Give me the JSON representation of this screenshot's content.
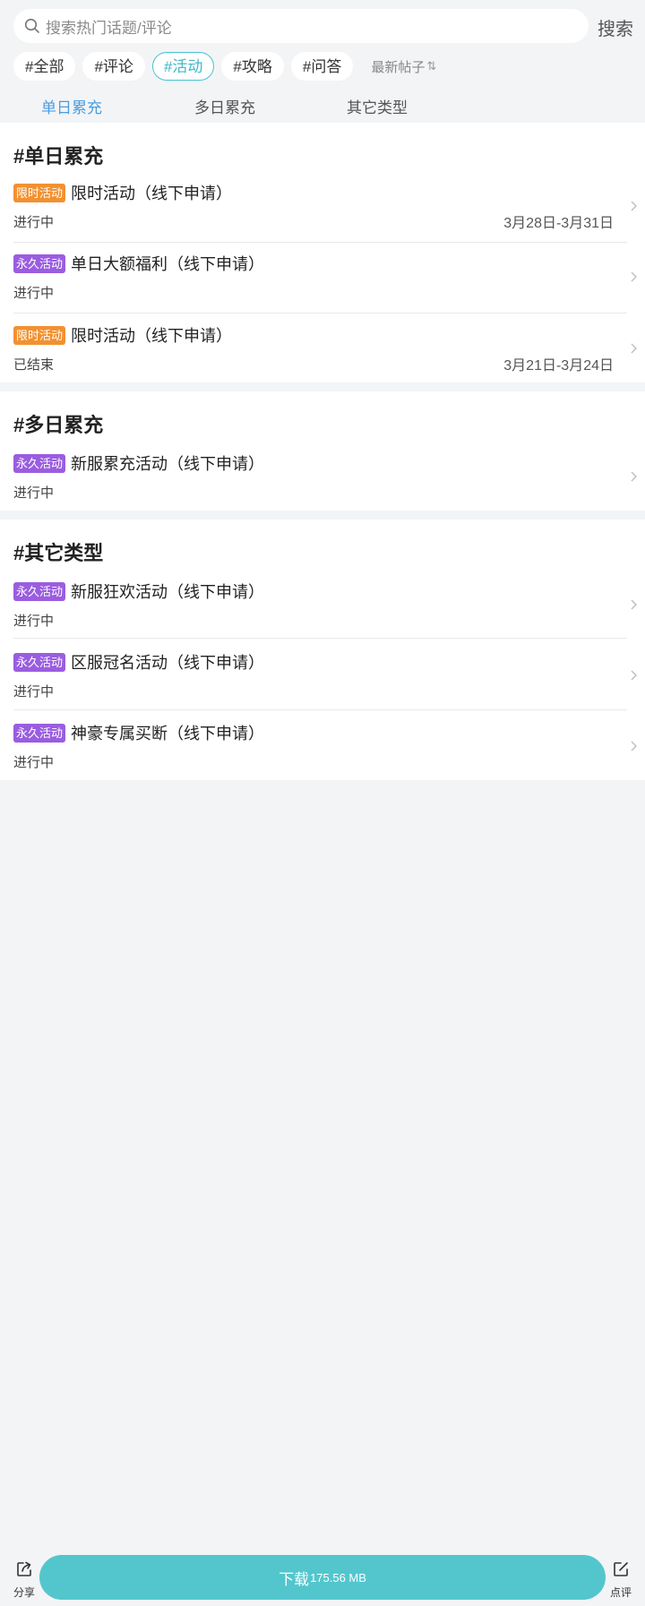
{
  "search": {
    "placeholder": "搜索热门话题/评论",
    "button": "搜索"
  },
  "chips": [
    {
      "label": "#全部"
    },
    {
      "label": "#评论"
    },
    {
      "label": "#活动"
    },
    {
      "label": "#攻略"
    },
    {
      "label": "#问答"
    }
  ],
  "active_chip": "#活动",
  "sort": {
    "label": "最新帖子",
    "icon": "sort-arrows-icon"
  },
  "tabs": [
    {
      "label": "单日累充"
    },
    {
      "label": "多日累充"
    },
    {
      "label": "其它类型"
    }
  ],
  "active_tab": "单日累充",
  "sections": [
    {
      "title": "#单日累充",
      "items": [
        {
          "badge": "限时活动",
          "title": "限时活动（线下申请）",
          "status": "进行中",
          "date": "3月28日-3月31日"
        },
        {
          "badge": "永久活动",
          "title": "单日大额福利（线下申请）",
          "status": "进行中",
          "date": ""
        },
        {
          "badge": "限时活动",
          "title": "限时活动（线下申请）",
          "status": "已结束",
          "date": "3月21日-3月24日"
        }
      ]
    },
    {
      "title": "#多日累充",
      "items": [
        {
          "badge": "永久活动",
          "title": "新服累充活动（线下申请）",
          "status": "进行中",
          "date": ""
        }
      ]
    },
    {
      "title": "#其它类型",
      "items": [
        {
          "badge": "永久活动",
          "title": "新服狂欢活动（线下申请）",
          "status": "进行中",
          "date": ""
        },
        {
          "badge": "永久活动",
          "title": "区服冠名活动（线下申请）",
          "status": "进行中",
          "date": ""
        },
        {
          "badge": "永久活动",
          "title": "神豪专属买断（线下申请）",
          "status": "进行中",
          "date": ""
        }
      ]
    }
  ],
  "bottom": {
    "share_label": "分享",
    "download_label": "下载",
    "download_size": "175.56 MB",
    "review_label": "点评"
  },
  "colors": {
    "accent": "#53c6cd",
    "tab_active": "#4a9de0",
    "badge_limited": "#f29130",
    "badge_permanent": "#9a5de0"
  }
}
